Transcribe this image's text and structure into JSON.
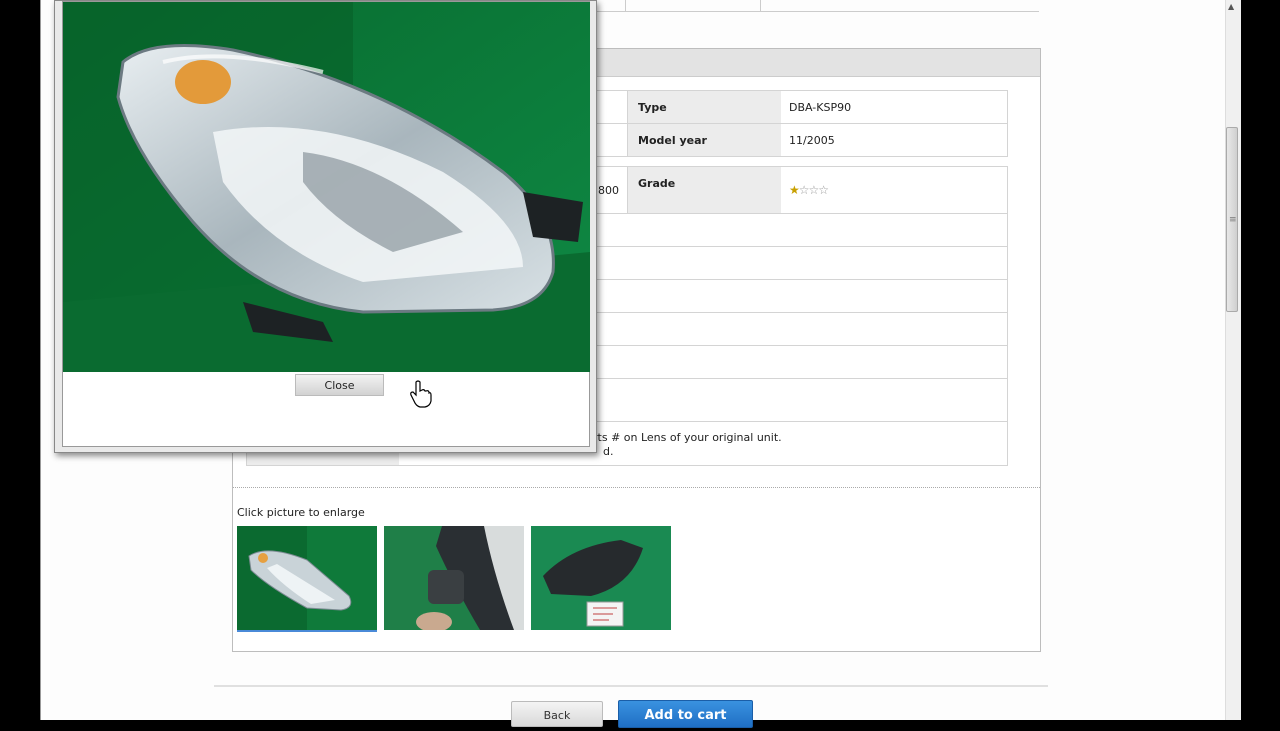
{
  "specs": {
    "type_label": "Type",
    "type_value": "DBA-KSP90",
    "model_year_label": "Model year",
    "model_year_value": "11/2005",
    "grade_label": "Grade",
    "grade_stars": {
      "filled": 1,
      "total": 4
    },
    "partial_left_value": "800",
    "note_line1": "rts # on Lens of your original unit.",
    "note_line2": "d."
  },
  "gallery": {
    "enlarge_label": "Click picture to enlarge",
    "thumbnails": [
      "headlight-front-photo",
      "headlight-mount-photo",
      "headlight-rear-label-photo"
    ]
  },
  "buttons": {
    "back_label": "Back",
    "add_to_cart_label": "Add to cart"
  },
  "popup": {
    "close_label": "Close"
  },
  "colors": {
    "accent_blue": "#1f6fc4",
    "star_gold": "#c8a000",
    "header_gray": "#e3e3e3"
  }
}
